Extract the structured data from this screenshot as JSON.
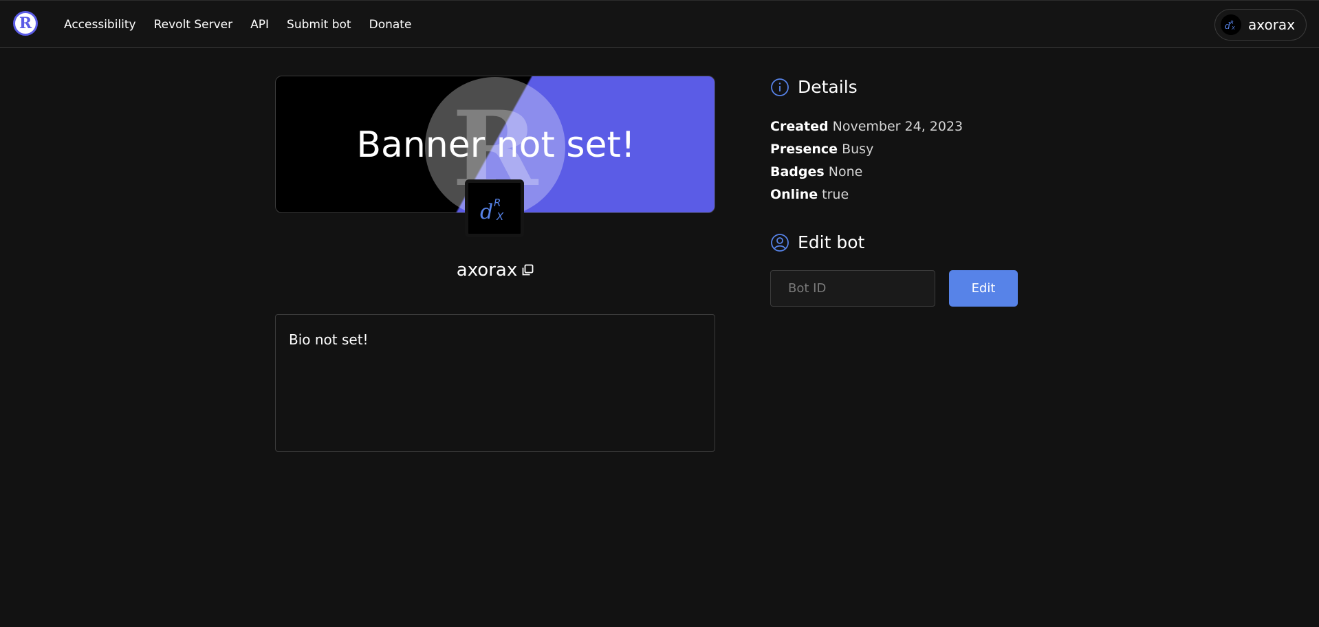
{
  "nav": {
    "logo_letter": "R",
    "links": [
      {
        "label": "Accessibility"
      },
      {
        "label": "Revolt Server"
      },
      {
        "label": "API"
      },
      {
        "label": "Submit bot"
      },
      {
        "label": "Donate"
      }
    ],
    "profile_name": "axorax"
  },
  "banner": {
    "text": "Banner not set!",
    "colors": {
      "left": "#000000",
      "right": "#5b5ce6"
    }
  },
  "bot": {
    "name": "axorax",
    "bio": "Bio not set!"
  },
  "details": {
    "title": "Details",
    "rows": [
      {
        "key": "Created",
        "value": "November 24, 2023"
      },
      {
        "key": "Presence",
        "value": "Busy"
      },
      {
        "key": "Badges",
        "value": "None"
      },
      {
        "key": "Online",
        "value": "true"
      }
    ]
  },
  "edit": {
    "title": "Edit bot",
    "input_placeholder": "Bot ID",
    "input_value": "",
    "button_label": "Edit"
  },
  "icons": {
    "logo": "revolt-logo-icon",
    "details": "info-circle-icon",
    "edit": "user-circle-icon",
    "copy": "copy-icon"
  },
  "colors": {
    "accent": "#5b5ce6",
    "button": "#5783e8",
    "icon_blue": "#5783e8",
    "background": "#121212"
  }
}
